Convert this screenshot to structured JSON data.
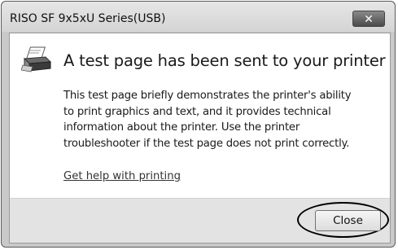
{
  "window": {
    "title": "RISO SF 9x5xU Series(USB)",
    "close_glyph": "✕"
  },
  "message": {
    "icon": "printer-icon",
    "heading": "A test page has been sent to your printer",
    "body_lines": [
      "This test page briefly demonstrates the printer's ability",
      "to print graphics and text, and it provides technical",
      "information about the printer. Use the printer",
      "troubleshooter if the test page does not print correctly."
    ],
    "help_link": "Get help with printing"
  },
  "footer": {
    "close_label": "Close"
  }
}
